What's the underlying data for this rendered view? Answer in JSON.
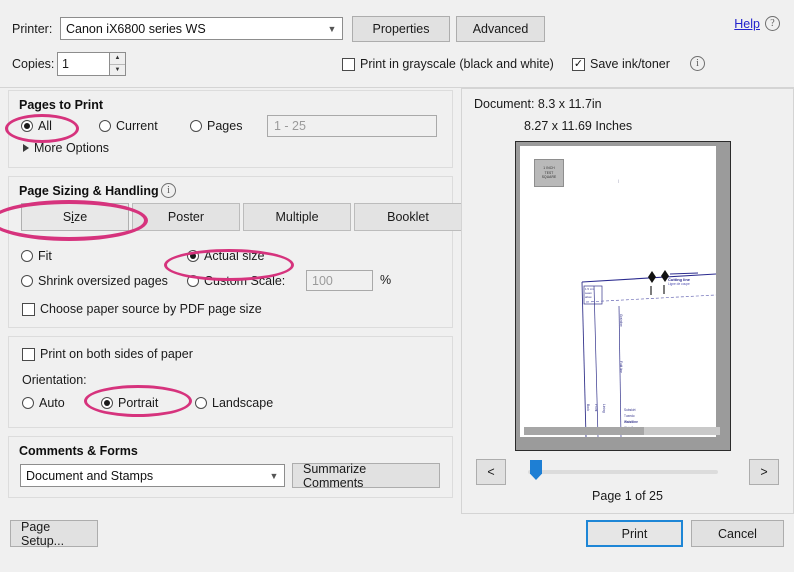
{
  "dialog": {
    "printer": {
      "label": "Printer:",
      "value": "Canon iX6800 series WS",
      "properties_button": "Properties",
      "advanced_button": "Advanced"
    },
    "help": {
      "link": "Help",
      "icon": "question-mark-icon"
    },
    "copies": {
      "label": "Copies:",
      "value": "1"
    },
    "grayscale_checkbox": {
      "label": "Print in grayscale (black and white)",
      "checked": false
    },
    "save_ink_checkbox": {
      "label": "Save ink/toner",
      "checked": true,
      "mark": "☑"
    },
    "info_icon": "info-icon"
  },
  "pages_to_print": {
    "title": "Pages to Print",
    "options": [
      {
        "label": "All",
        "selected": true
      },
      {
        "label": "Current",
        "selected": false
      },
      {
        "label": "Pages",
        "selected": false
      }
    ],
    "range_placeholder": "1 - 25",
    "more_options": "More Options"
  },
  "page_sizing": {
    "title": "Page Sizing & Handling",
    "info_icon": "info-icon",
    "tabs": [
      {
        "label": "Size",
        "active": true,
        "mnemonic": "i"
      },
      {
        "label": "Poster",
        "active": false
      },
      {
        "label": "Multiple",
        "active": false
      },
      {
        "label": "Booklet",
        "active": false
      }
    ],
    "scale_options": [
      {
        "label": "Fit",
        "selected": false
      },
      {
        "label": "Actual size",
        "selected": true
      },
      {
        "label": "Shrink oversized pages",
        "selected": false
      },
      {
        "label": "Custom Scale:",
        "selected": false
      }
    ],
    "custom_scale_value": "100",
    "percent_symbol": "%",
    "paper_source_checkbox": {
      "label": "Choose paper source by PDF page size",
      "checked": false
    }
  },
  "duplex": {
    "both_sides_checkbox": {
      "label": "Print on both sides of paper",
      "checked": false
    },
    "orientation_label": "Orientation:",
    "orientation_options": [
      {
        "label": "Auto",
        "selected": false
      },
      {
        "label": "Portrait",
        "selected": true
      },
      {
        "label": "Landscape",
        "selected": false
      }
    ]
  },
  "comments_forms": {
    "title": "Comments & Forms",
    "selected": "Document and Stamps",
    "summarize_button": "Summarize Comments"
  },
  "preview": {
    "document_size": "Document: 8.3 x 11.7in",
    "paper_size": "8.27 x 11.69 Inches",
    "test_square": {
      "line1": "1 INCH",
      "line2": "TEST",
      "line3": "SQUARE"
    },
    "pattern_labels": {
      "cutting_line": "Cutting line",
      "cutting_line_sub": "Ligne de coupe",
      "seam_note": "1.5 cm\nseam\nallow",
      "vertical_1": "Grainline",
      "vertical_2": "Fold line",
      "bottom_1": "Subskirt",
      "bottom_2": "Tuxedo",
      "bottom_3": "Waistline",
      "bottom_4": "Waistline",
      "side_1": "Back",
      "side_2": "Front",
      "side_3": "Lining"
    },
    "nav": {
      "prev": "<",
      "next": ">",
      "page_status": "Page 1 of 25",
      "current_page": 1,
      "total_pages": 25
    }
  },
  "footer": {
    "page_setup": "Page Setup...",
    "print": "Print",
    "cancel": "Cancel"
  },
  "annotations": {
    "color": "#d6337d",
    "highlighted": [
      "All",
      "Size",
      "Actual size",
      "Portrait"
    ]
  }
}
